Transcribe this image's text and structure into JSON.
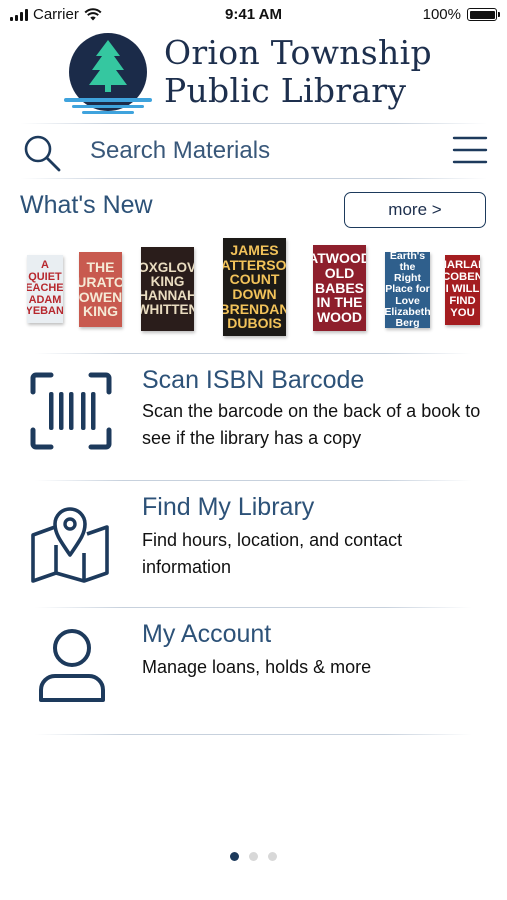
{
  "status_bar": {
    "carrier": "Carrier",
    "time": "9:41 AM",
    "battery": "100%",
    "battery_level": 1.0
  },
  "header": {
    "title_line1": "Orion Township",
    "title_line2": "Public Library",
    "logo_icon": "tree-over-water-logo"
  },
  "search": {
    "placeholder": "Search Materials",
    "value": ""
  },
  "whats_new": {
    "title": "What's New",
    "more_label": "more >",
    "books": [
      {
        "lines": [
          "A QUIET",
          "TEACHER",
          "ADAM",
          "OYEBANJI"
        ],
        "bg": "#e9eef2",
        "fg": "#b7282e"
      },
      {
        "lines": [
          "THE",
          "CURATOR",
          "OWEN KING"
        ],
        "bg": "#c85a4f",
        "fg": "#f5ead6"
      },
      {
        "lines": [
          "FOXGLOVE",
          "KING",
          "HANNAH",
          "WHITTEN"
        ],
        "bg": "#2a1d1b",
        "fg": "#e9dcc0"
      },
      {
        "lines": [
          "JAMES PATTERSON",
          "COUNT",
          "DOWN",
          "BRENDAN DUBOIS"
        ],
        "bg": "#1c1a17",
        "fg": "#f2c35a"
      },
      {
        "lines": [
          "ATWOOD",
          "OLD BABES IN THE WOOD"
        ],
        "bg": "#8e1f2c",
        "fg": "#ffffff"
      },
      {
        "lines": [
          "Earth's",
          "the Right",
          "Place for",
          "Love",
          "Elizabeth Berg"
        ],
        "bg": "#2f5f8c",
        "fg": "#ffffff"
      },
      {
        "lines": [
          "HARLAN",
          "COBEN",
          "I WILL",
          "FIND YOU"
        ],
        "bg": "#a41d20",
        "fg": "#ffffff"
      }
    ]
  },
  "features": [
    {
      "title": "Scan ISBN Barcode",
      "desc": "Scan the barcode on the back of a book to see if the library has a copy",
      "icon": "barcode-scan-icon"
    },
    {
      "title": "Find My Library",
      "desc": "Find hours, location, and contact information",
      "icon": "map-pin-icon"
    },
    {
      "title": "My Account",
      "desc": "Manage loans, holds & more",
      "icon": "user-icon"
    }
  ],
  "pager": {
    "count": 3,
    "active_index": 0
  },
  "colors": {
    "brand_navy": "#1d3a5c",
    "brand_teal": "#2fbf9c",
    "logo_circle": "#1b2b49",
    "water_blue": "#3fa3dd"
  }
}
